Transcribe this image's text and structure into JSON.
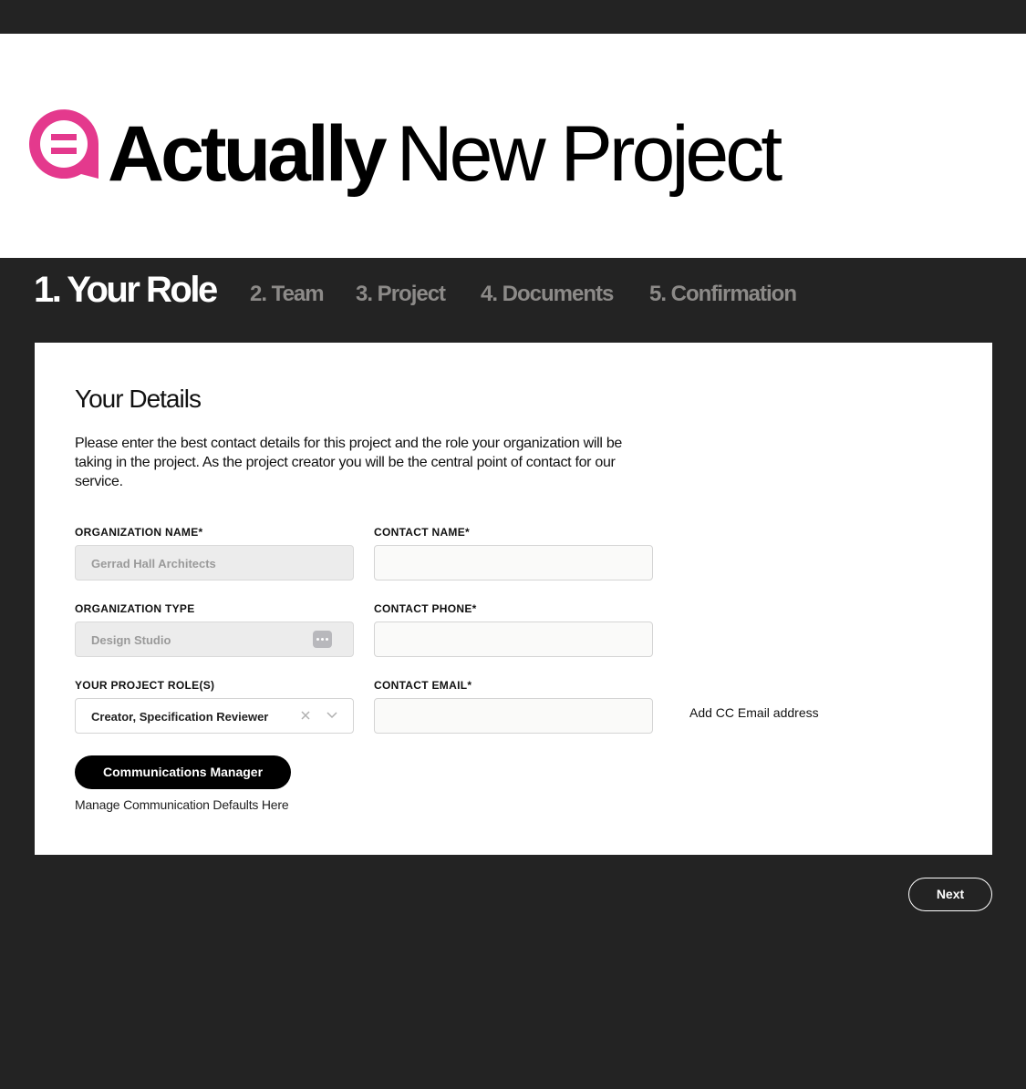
{
  "brand": {
    "name_bold": "Actually",
    "name_light": "New Project",
    "accent_color": "#e4398d",
    "logo_icon": "actually-logo-icon"
  },
  "steps": [
    {
      "label": "1. Your Role",
      "active": true
    },
    {
      "label": "2. Team",
      "active": false
    },
    {
      "label": "3. Project",
      "active": false
    },
    {
      "label": "4. Documents",
      "active": false
    },
    {
      "label": "5. Confirmation",
      "active": false
    }
  ],
  "form": {
    "title": "Your Details",
    "description": "Please enter the best contact details for this project and the role your organization will be taking in the project. As the project creator you will be the central point of contact for our service.",
    "org_name": {
      "label": "ORGANIZATION NAME*",
      "value": "Gerrad Hall Architects"
    },
    "org_type": {
      "label": "ORGANIZATION TYPE",
      "value": "Design Studio"
    },
    "project_roles": {
      "label": "YOUR PROJECT ROLE(S)",
      "value": "Creator, Specification Reviewer"
    },
    "contact_name": {
      "label": "CONTACT NAME*",
      "value": ""
    },
    "contact_phone": {
      "label": "CONTACT PHONE*",
      "value": ""
    },
    "contact_email": {
      "label": "CONTACT EMAIL*",
      "value": ""
    },
    "cc_link": "Add CC Email address",
    "comm_button": "Communications Manager",
    "comm_hint": "Manage Communication Defaults Here"
  },
  "nav": {
    "next_label": "Next"
  }
}
